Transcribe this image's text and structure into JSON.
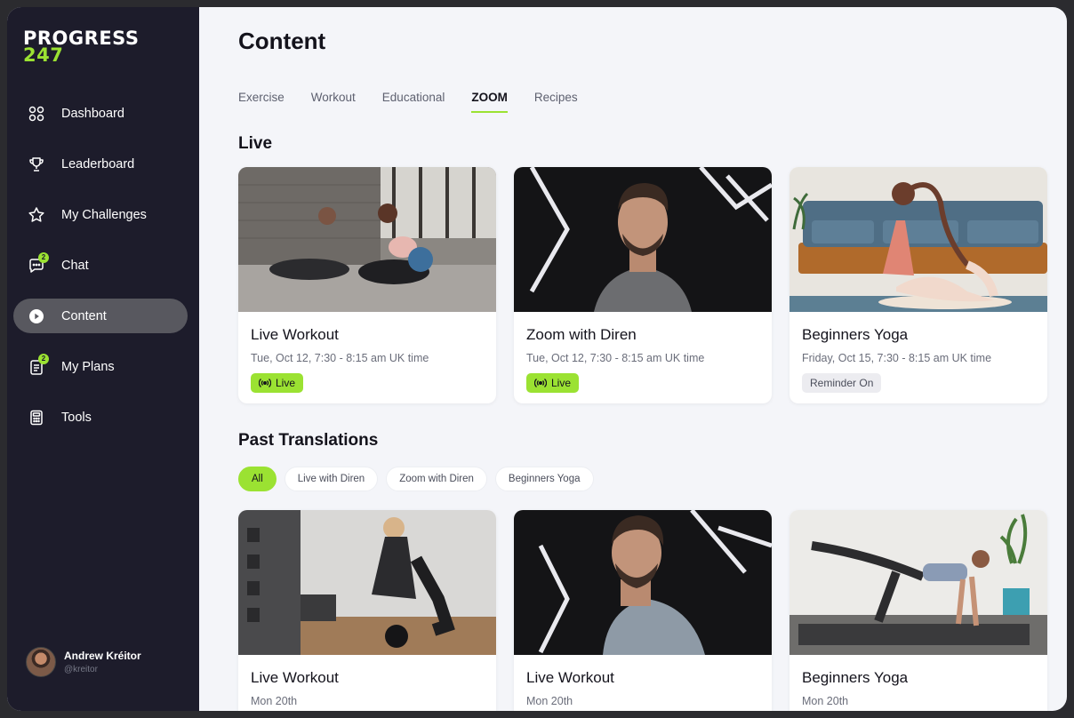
{
  "brand": {
    "line1": "PROGRESS",
    "line2": "247",
    "accent": "#9be232"
  },
  "sidebar": {
    "items": [
      {
        "label": "Dashboard",
        "icon": "grid-icon"
      },
      {
        "label": "Leaderboard",
        "icon": "trophy-icon"
      },
      {
        "label": "My Challenges",
        "icon": "star-icon"
      },
      {
        "label": "Chat",
        "icon": "chat-icon",
        "badge": "2"
      },
      {
        "label": "Content",
        "icon": "play-icon",
        "active": true
      },
      {
        "label": "My Plans",
        "icon": "plans-icon",
        "badge": "2"
      },
      {
        "label": "Tools",
        "icon": "calculator-icon"
      }
    ]
  },
  "profile": {
    "name": "Andrew Kréitor",
    "handle": "@kreitor"
  },
  "main": {
    "title": "Content",
    "tabs": [
      "Exercise",
      "Workout",
      "Educational",
      "ZOOM",
      "Recipes"
    ],
    "active_tab": "ZOOM",
    "live": {
      "title": "Live",
      "cards": [
        {
          "title": "Live Workout",
          "time": "Tue, Oct 12, 7:30 - 8:15 am UK time",
          "status": "Live"
        },
        {
          "title": "Zoom with Diren",
          "time": "Tue, Oct 12, 7:30 - 8:15 am UK time",
          "status": "Live"
        },
        {
          "title": "Beginners Yoga",
          "time": "Friday, Oct 15, 7:30 - 8:15 am UK time",
          "status": "Reminder On"
        }
      ]
    },
    "past": {
      "title": "Past Translations",
      "filters": [
        "All",
        "Live with Diren",
        "Zoom with Diren",
        "Beginners Yoga"
      ],
      "active_filter": "All",
      "cards": [
        {
          "title": "Live Workout",
          "date": "Mon 20th"
        },
        {
          "title": "Live Workout",
          "date": "Mon 20th"
        },
        {
          "title": "Beginners Yoga",
          "date": "Mon 20th"
        }
      ]
    }
  }
}
